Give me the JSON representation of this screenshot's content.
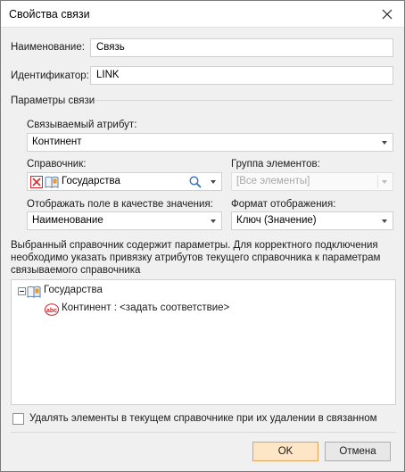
{
  "window": {
    "title": "Свойства связи"
  },
  "name": {
    "label": "Наименование:",
    "value": "Связь"
  },
  "identifier": {
    "label": "Идентификатор:",
    "value": "LINK"
  },
  "params_group": {
    "label": "Параметры связи"
  },
  "linked_attribute": {
    "label": "Связываемый атрибут:",
    "value": "Континент"
  },
  "dictionary": {
    "label": "Справочник:",
    "value": "Государства"
  },
  "element_group": {
    "label": "Группа элементов:",
    "value": "[Все элементы]"
  },
  "display_field": {
    "label": "Отображать поле в качестве значения:",
    "value": "Наименование"
  },
  "display_format": {
    "label": "Формат отображения:",
    "value": "Ключ (Значение)"
  },
  "info_text": {
    "line1": "Выбранный справочник содержит параметры. Для корректного подключения",
    "line2": "необходимо указать привязку атрибутов текущего справочника к параметрам",
    "line3": "связываемого справочника"
  },
  "tree": {
    "root": {
      "label": "Государства",
      "icon": "dictionary-icon"
    },
    "children": [
      {
        "label": "Континент : <задать соответствие>",
        "icon": "text-attribute-icon"
      }
    ]
  },
  "delete_option": {
    "label": "Удалять элементы в текущем справочнике при их удалении в связанном",
    "checked": false
  },
  "buttons": {
    "ok": "OK",
    "cancel": "Отмена"
  },
  "colors": {
    "primary_button": "#fde6c6",
    "primary_border": "#e0a35a",
    "clear_icon": "#d9272e"
  }
}
